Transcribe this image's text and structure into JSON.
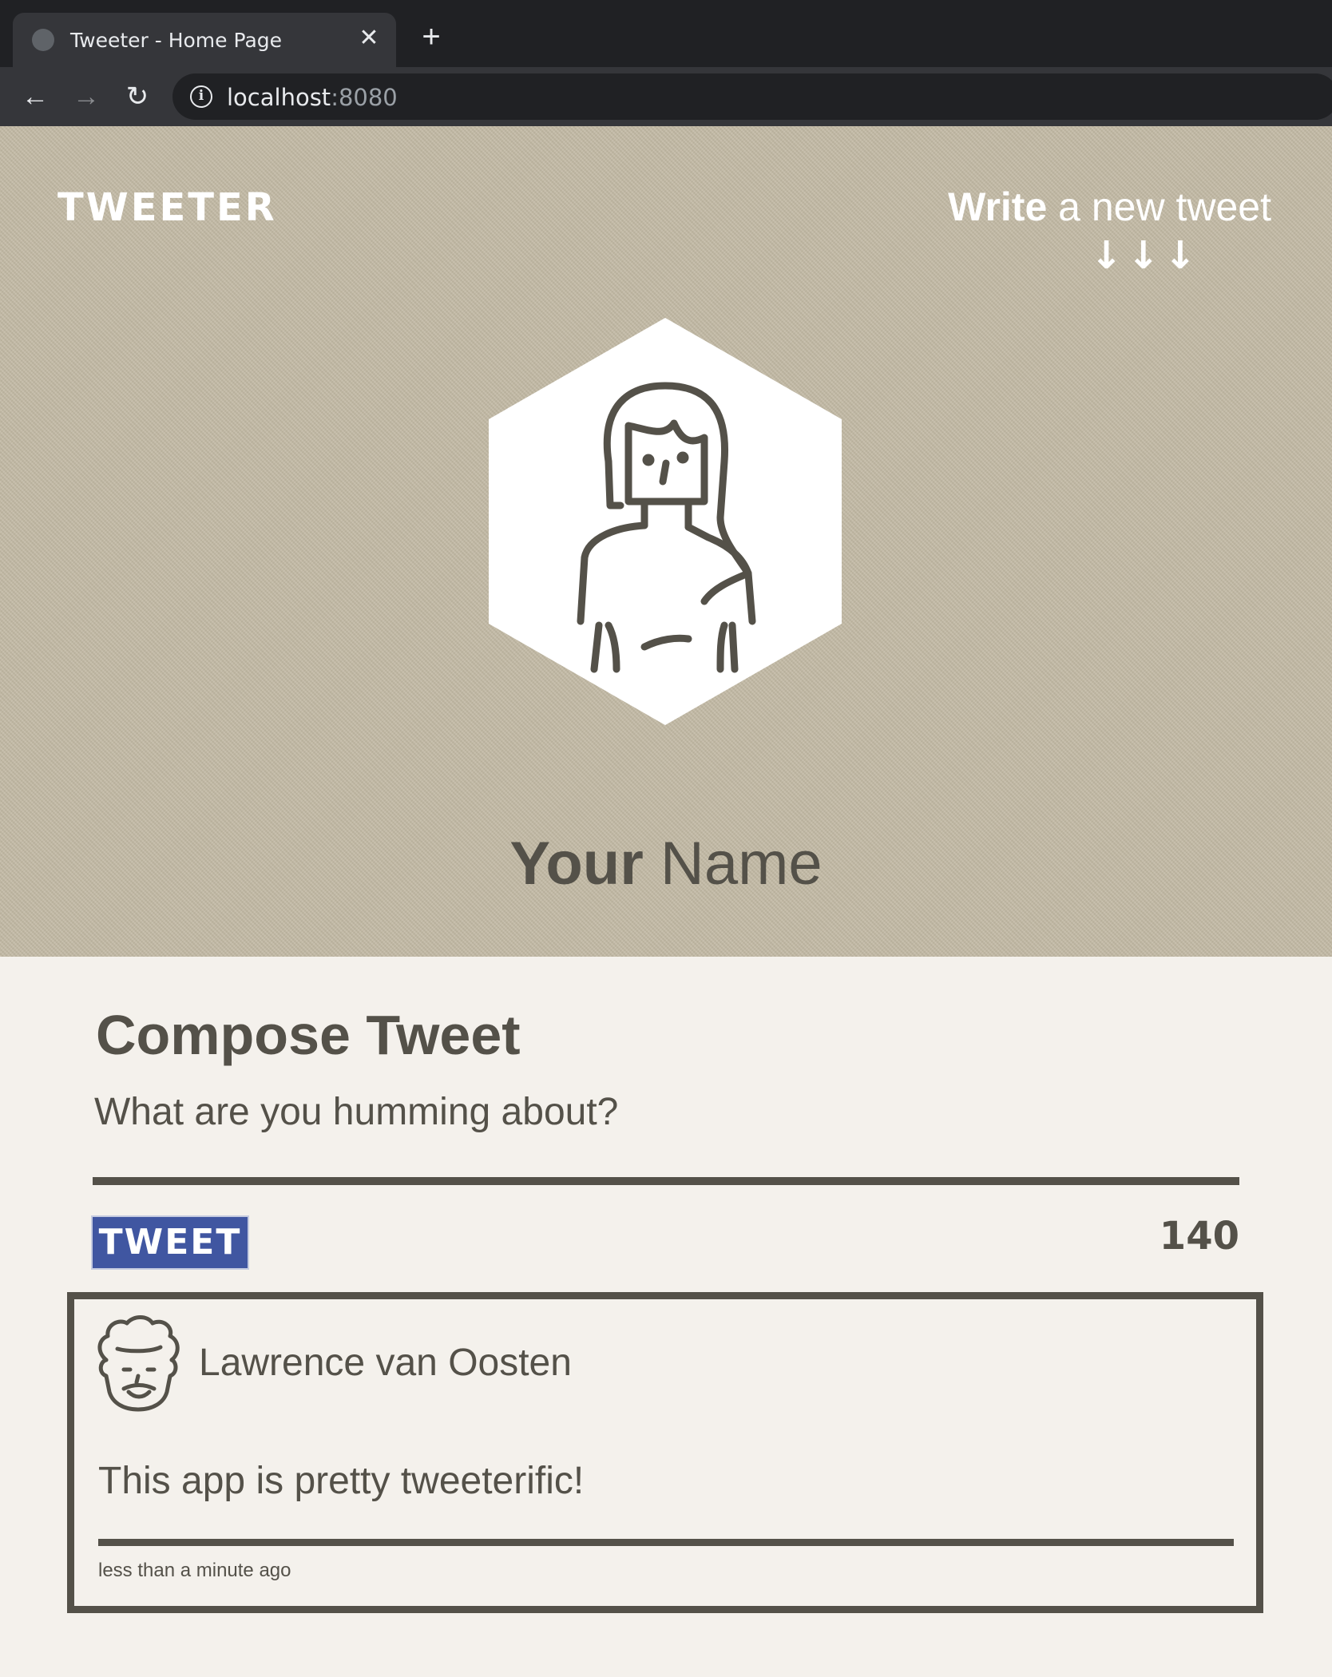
{
  "browser": {
    "tab_title": "Tweeter - Home Page",
    "tab_close": "✕",
    "new_tab": "+",
    "url_host": "localhost",
    "url_port": ":8080",
    "back": "←",
    "forward": "→",
    "reload": "↻",
    "info": "i"
  },
  "nav": {
    "brand": "TWEETER",
    "write_bold": "Write",
    "write_rest": " a new tweet",
    "write_arrows": "↓↓↓"
  },
  "profile": {
    "name_bold": "Your",
    "name_rest": " Name",
    "avatar_icon": "woman-avatar-icon"
  },
  "compose": {
    "title": "Compose Tweet",
    "placeholder": "What are you humming about?",
    "button_label": "TWEET",
    "counter": "140"
  },
  "tweets": [
    {
      "author": "Lawrence van Oosten",
      "avatar_icon": "man-avatar-icon",
      "text": "This app is pretty tweeterific!",
      "time": "less than a minute ago"
    }
  ],
  "colors": {
    "text": "#545149",
    "hero_bg": "#c3baa5",
    "page_bg": "#f4f1ec",
    "button": "#4056a1"
  }
}
